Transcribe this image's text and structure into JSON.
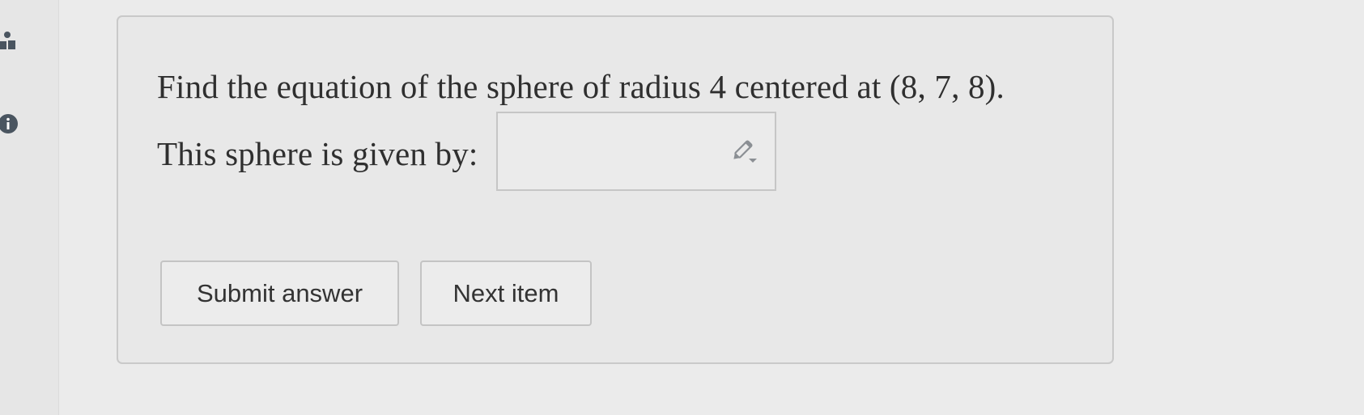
{
  "question": {
    "prompt": "Find the equation of the sphere of radius 4 centered at (8, 7, 8).",
    "answer_label": "This sphere is given by:",
    "answer_value": ""
  },
  "buttons": {
    "submit_label": "Submit answer",
    "next_label": "Next item"
  },
  "sidebar": {
    "icons": [
      "person-icon",
      "info-icon"
    ]
  },
  "colors": {
    "background": "#ebebeb",
    "card_border": "#c9c9c9",
    "text": "#2f2f2f",
    "icon": "#4a5560"
  }
}
